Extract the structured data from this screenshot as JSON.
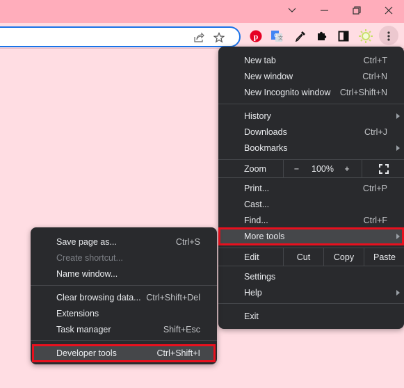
{
  "window": {
    "controls": [
      {
        "name": "tab-search",
        "icon": "chevron-down-icon",
        "glyph": "⌄"
      },
      {
        "name": "minimize",
        "icon": "minimize-icon",
        "glyph": "—"
      },
      {
        "name": "restore",
        "icon": "restore-icon",
        "glyph": "❐"
      },
      {
        "name": "close",
        "icon": "close-icon",
        "glyph": "✕"
      }
    ]
  },
  "toolbar": {
    "omnibox_value": "",
    "omnibox_icons": [
      "share-icon",
      "bookmark-star-icon"
    ],
    "extensions": [
      "pinterest-icon",
      "google-translate-icon",
      "eyedropper-icon",
      "extensions-puzzle-icon",
      "side-panel-icon",
      "sun-extension-icon"
    ],
    "menu_icon": "kebab-menu-icon",
    "accent_color": "#1a73e8"
  },
  "main_menu": {
    "group1": [
      {
        "label": "New tab",
        "shortcut": "Ctrl+T"
      },
      {
        "label": "New window",
        "shortcut": "Ctrl+N"
      },
      {
        "label": "New Incognito window",
        "shortcut": "Ctrl+Shift+N"
      }
    ],
    "group2": [
      {
        "label": "History",
        "shortcut": "",
        "submenu": true
      },
      {
        "label": "Downloads",
        "shortcut": "Ctrl+J"
      },
      {
        "label": "Bookmarks",
        "shortcut": "",
        "submenu": true
      }
    ],
    "zoom": {
      "label": "Zoom",
      "minus": "−",
      "value": "100%",
      "plus": "+",
      "fullscreen_icon": "fullscreen-icon"
    },
    "group3": [
      {
        "label": "Print...",
        "shortcut": "Ctrl+P"
      },
      {
        "label": "Cast...",
        "shortcut": ""
      },
      {
        "label": "Find...",
        "shortcut": "Ctrl+F"
      },
      {
        "label": "More tools",
        "shortcut": "",
        "submenu": true,
        "highlighted": true
      }
    ],
    "edit": {
      "label": "Edit",
      "cut": "Cut",
      "copy": "Copy",
      "paste": "Paste"
    },
    "group4": [
      {
        "label": "Settings",
        "shortcut": ""
      },
      {
        "label": "Help",
        "shortcut": "",
        "submenu": true
      }
    ],
    "exit": {
      "label": "Exit"
    }
  },
  "more_tools_menu": {
    "group1": [
      {
        "label": "Save page as...",
        "shortcut": "Ctrl+S",
        "disabled": false
      },
      {
        "label": "Create shortcut...",
        "shortcut": "",
        "disabled": true
      },
      {
        "label": "Name window...",
        "shortcut": "",
        "disabled": false
      }
    ],
    "group2": [
      {
        "label": "Clear browsing data...",
        "shortcut": "Ctrl+Shift+Del"
      },
      {
        "label": "Extensions",
        "shortcut": ""
      },
      {
        "label": "Task manager",
        "shortcut": "Shift+Esc"
      }
    ],
    "devtools": {
      "label": "Developer tools",
      "shortcut": "Ctrl+Shift+I",
      "highlighted": true
    }
  },
  "colors": {
    "titlebar": "#ffadbb",
    "page_bg": "#ffdde3",
    "menu_bg": "#292a2d",
    "highlight_border": "#e8101e"
  }
}
